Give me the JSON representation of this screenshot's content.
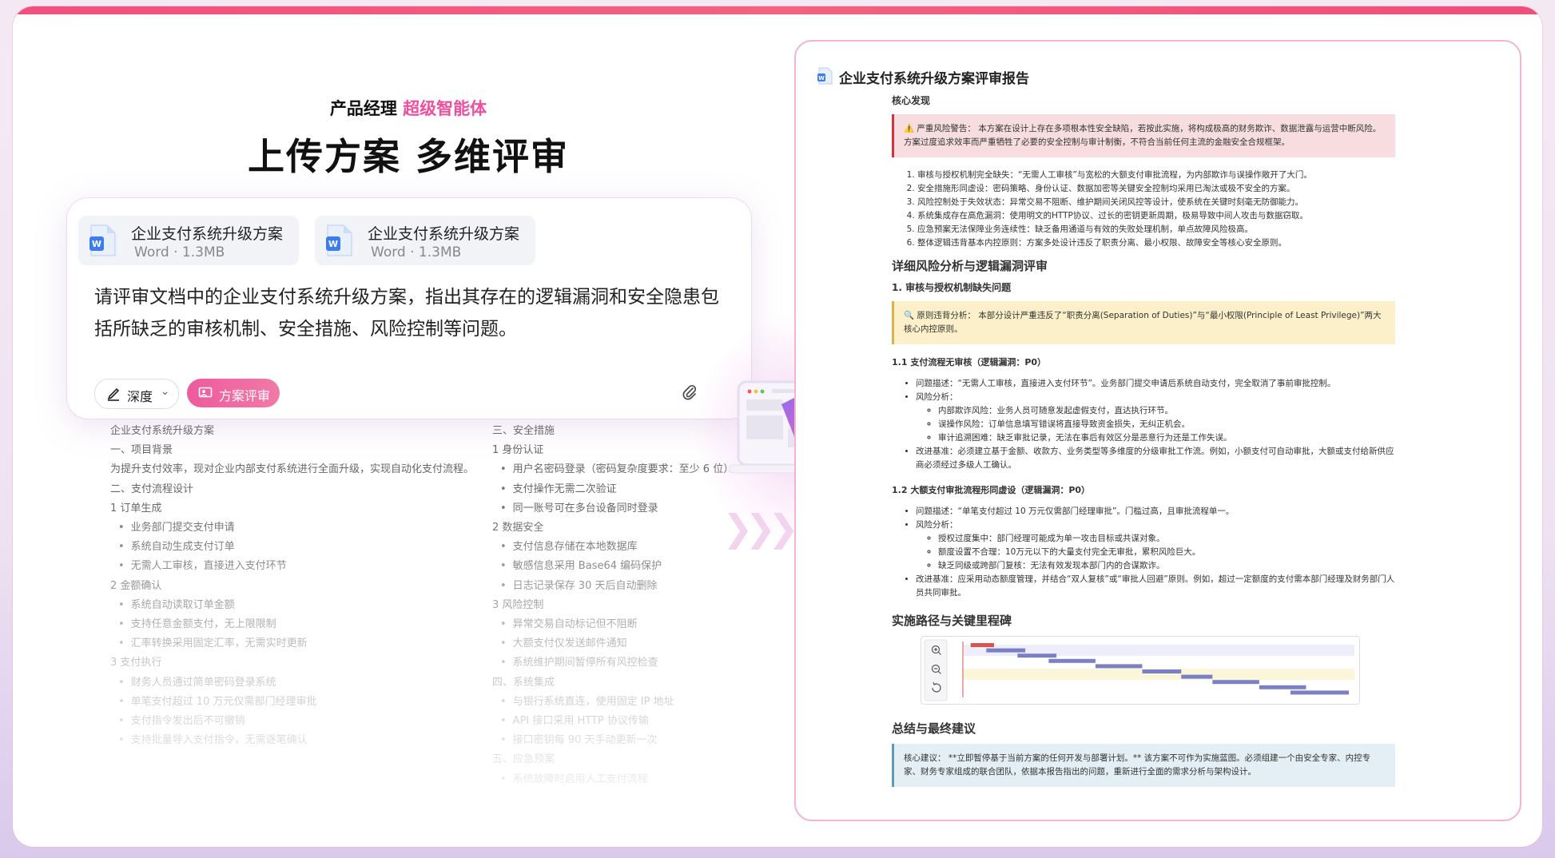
{
  "hero": {
    "subtitle_prefix": "产品经理 ",
    "subtitle_accent": "超级智能体",
    "headline": "上传方案 多维评审"
  },
  "chat": {
    "files": [
      {
        "name": "企业支付系统升级方案",
        "meta": "Word · 1.3MB"
      },
      {
        "name": "企业支付系统升级方案",
        "meta": "Word · 1.3MB"
      }
    ],
    "prompt": "请评审文档中的企业支付系统升级方案，指出其存在的逻辑漏洞和安全隐患包括所缺乏的审核机制、安全措施、风险控制等问题。",
    "depth_label": "深度",
    "review_label": "方案评审"
  },
  "doc_left": [
    {
      "text": "企业支付系统升级方案",
      "bullet": false
    },
    {
      "text": "一、项目背景",
      "bullet": false
    },
    {
      "text": "为提升支付效率，现对企业内部支付系统进行全面升级，实现自动化支付流程。",
      "bullet": false
    },
    {
      "text": "二、支付流程设计",
      "bullet": false
    },
    {
      "text": "1 订单生成",
      "bullet": false
    },
    {
      "text": "业务部门提交支付申请",
      "bullet": true
    },
    {
      "text": "系统自动生成支付订单",
      "bullet": true
    },
    {
      "text": "无需人工审核，直接进入支付环节",
      "bullet": true
    },
    {
      "text": "2 金额确认",
      "bullet": false
    },
    {
      "text": "系统自动读取订单金额",
      "bullet": true
    },
    {
      "text": "支持任意金额支付，无上限限制",
      "bullet": true
    },
    {
      "text": "汇率转换采用固定汇率，无需实时更新",
      "bullet": true
    },
    {
      "text": "3 支付执行",
      "bullet": false
    },
    {
      "text": "财务人员通过简单密码登录系统",
      "bullet": true
    },
    {
      "text": "单笔支付超过 10 万元仅需部门经理审批",
      "bullet": true
    },
    {
      "text": "支付指令发出后不可撤销",
      "bullet": true
    },
    {
      "text": "支持批量导入支付指令，无需逐笔确认",
      "bullet": true
    }
  ],
  "doc_right": [
    {
      "text": "三、安全措施",
      "bullet": false
    },
    {
      "text": "1 身份认证",
      "bullet": false
    },
    {
      "text": "用户名密码登录（密码复杂度要求：至少 6 位）",
      "bullet": true
    },
    {
      "text": "支付操作无需二次验证",
      "bullet": true
    },
    {
      "text": "同一账号可在多台设备同时登录",
      "bullet": true
    },
    {
      "text": "2 数据安全",
      "bullet": false
    },
    {
      "text": "支付信息存储在本地数据库",
      "bullet": true
    },
    {
      "text": "敏感信息采用 Base64 编码保护",
      "bullet": true
    },
    {
      "text": "日志记录保存 30 天后自动删除",
      "bullet": true
    },
    {
      "text": "3 风险控制",
      "bullet": false
    },
    {
      "text": "异常交易自动标记但不阻断",
      "bullet": true
    },
    {
      "text": "大额支付仅发送邮件通知",
      "bullet": true
    },
    {
      "text": "系统维护期间暂停所有风控检查",
      "bullet": true
    },
    {
      "text": "四、系统集成",
      "bullet": false
    },
    {
      "text": "与银行系统直连，使用固定 IP 地址",
      "bullet": true
    },
    {
      "text": "API 接口采用 HTTP 协议传输",
      "bullet": true
    },
    {
      "text": "接口密钥每 90 天手动更新一次",
      "bullet": true
    },
    {
      "text": "五、应急预案",
      "bullet": false
    },
    {
      "text": "系统故障时启用人工支付流程",
      "bullet": true
    }
  ],
  "report": {
    "title": "企业支付系统升级方案评审报告",
    "core_heading": "核心发现",
    "alert": "⚠️ 严重风险警告： 本方案在设计上存在多项根本性安全缺陷，若按此实施，将构成极高的财务欺诈、数据泄露与运营中断风险。方案过度追求效率而严重牺牲了必要的安全控制与审计制衡，不符合当前任何主流的金融安全合规框架。",
    "findings": [
      "审核与授权机制完全缺失：“无需人工审核”与宽松的大额支付审批流程，为内部欺诈与误操作敞开了大门。",
      "安全措施形同虚设：密码策略、身份认证、数据加密等关键安全控制均采用已淘汰或极不安全的方案。",
      "风险控制处于失效状态：异常交易不阻断、维护期间关闭风控等设计，使系统在关键时刻毫无防御能力。",
      "系统集成存在高危漏洞：使用明文的HTTP协议、过长的密钥更新周期，极易导致中间人攻击与数据窃取。",
      "应急预案无法保障业务连续性：缺乏备用通道与有效的失败处理机制，单点故障风险极高。",
      "整体逻辑违背基本内控原则：方案多处设计违反了职责分离、最小权限、故障安全等核心安全原则。"
    ],
    "detail_heading": "详细风险分析与逻辑漏洞评审",
    "sec1_heading": "1. 审核与授权机制缺失问题",
    "principle": "🔍 原则违背分析： 本部分设计严重违反了“职责分离(Separation of Duties)”与“最小权限(Principle of Least Privilege)”两大核心内控原则。",
    "s11_heading": "1.1 支付流程无审核（逻辑漏洞：P0）",
    "s11_problem": "问题描述：“无需人工审核，直接进入支付环节”。业务部门提交申请后系统自动支付，完全取消了事前审批控制。",
    "s11_risk": "风险分析：",
    "s11_risks": [
      "内部欺诈风险：业务人员可随意发起虚假支付，直达执行环节。",
      "误操作风险：订单信息填写错误将直接导致资金损失，无纠正机会。",
      "审计追溯困难：缺乏审批记录，无法在事后有效区分是恶意行为还是工作失误。"
    ],
    "s11_fix": "改进基准：必须建立基于金额、收款方、业务类型等多维度的分级审批工作流。例如，小额支付可自动审批，大额或支付给新供应商必须经过多级人工确认。",
    "s12_heading": "1.2 大额支付审批流程形同虚设（逻辑漏洞：P0）",
    "s12_problem": "问题描述：“单笔支付超过 10 万元仅需部门经理审批”。门槛过高，且审批流程单一。",
    "s12_risk": "风险分析：",
    "s12_risks": [
      "授权过度集中：部门经理可能成为单一攻击目标或共谋对象。",
      "额度设置不合理：10万元以下的大量支付完全无审批，累积风险巨大。",
      "缺乏同级或跨部门复核：无法有效发现本部门内的合谋欺诈。"
    ],
    "s12_fix": "改进基准：应采用动态额度管理，并结合“双人复核”或“审批人回避”原则。例如，超过一定额度的支付需本部门经理及财务部门人员共同审批。",
    "impl_heading": "实施路径与关键里程碑",
    "summary_heading": "总结与最终建议",
    "summary": "核心建议： **立即暂停基于当前方案的任何开发与部署计划。** 该方案不可作为实施蓝图。必须组建一个由安全专家、内控专家、财务专家组成的联合团队，依据本报告指出的问题，重新进行全面的需求分析与架构设计。"
  },
  "gantt": {
    "tasks": [
      {
        "start": 0.02,
        "end": 0.08,
        "color": "#d9534f"
      },
      {
        "start": 0.06,
        "end": 0.16,
        "color": "#7b7fc4"
      },
      {
        "start": 0.14,
        "end": 0.24,
        "color": "#7b7fc4"
      },
      {
        "start": 0.22,
        "end": 0.34,
        "color": "#7b7fc4"
      },
      {
        "start": 0.34,
        "end": 0.46,
        "color": "#7b7fc4"
      },
      {
        "start": 0.46,
        "end": 0.56,
        "color": "#7b7fc4"
      },
      {
        "start": 0.56,
        "end": 0.64,
        "color": "#7b7fc4"
      },
      {
        "start": 0.64,
        "end": 0.76,
        "color": "#7b7fc4"
      },
      {
        "start": 0.76,
        "end": 0.88,
        "color": "#7b7fc4"
      },
      {
        "start": 0.84,
        "end": 0.99,
        "color": "#7b7fc4"
      }
    ]
  }
}
